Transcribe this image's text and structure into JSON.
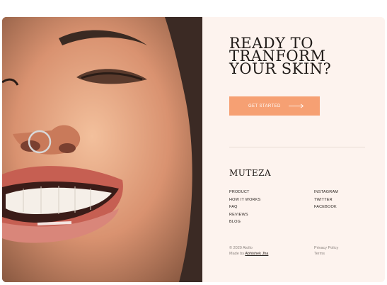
{
  "hero": {
    "headline_lines": [
      "READY TO",
      "TRANFORM",
      "YOUR SKIN?"
    ],
    "cta_label": "GET STARTED",
    "cta_color": "#f6a073",
    "background_color": "#fdf3ee"
  },
  "brand": {
    "name": "MUTEZA"
  },
  "nav": {
    "links": [
      "PRODUCT",
      "HOW IT WORKS",
      "FAQ",
      "REVIEWS",
      "BLOG"
    ]
  },
  "social": {
    "links": [
      "INSTAGRAM",
      "TWITTER",
      "FACEBOOK"
    ]
  },
  "footer": {
    "copyright": "© 2020 Atollo",
    "made_by_prefix": "Made by",
    "made_by_name": "Abhishek Jha",
    "privacy": "Privacy Policy",
    "terms": "Terms"
  },
  "icons": {
    "cta_arrow": "arrow-right-icon"
  }
}
